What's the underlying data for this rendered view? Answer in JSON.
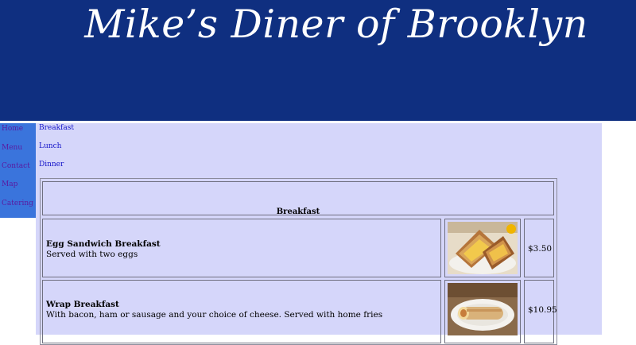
{
  "site": {
    "title": "Mike’s Diner of Brooklyn"
  },
  "nav": {
    "items": [
      {
        "label": "Home"
      },
      {
        "label": "Menu"
      },
      {
        "label": "Contact"
      },
      {
        "label": "Map"
      },
      {
        "label": "Catering"
      }
    ]
  },
  "submenu": {
    "links": [
      {
        "label": "Breakfast"
      },
      {
        "label": "Lunch"
      },
      {
        "label": "Dinner"
      }
    ]
  },
  "menu": {
    "section_title": "Breakfast",
    "items": [
      {
        "name": "Egg Sandwich Breakfast",
        "description": "Served with two eggs",
        "price": "$3.50",
        "image_icon": "egg-sandwich-photo"
      },
      {
        "name": "Wrap Breakfast",
        "description": "With bacon, ham or sausage and your choice of cheese. Served with home fries",
        "price": "$10.95",
        "image_icon": "breakfast-wrap-photo"
      }
    ]
  },
  "colors": {
    "header_bg": "#0f2f80",
    "sidebar_bg": "#3a74dc",
    "content_bg": "#d5d6fa",
    "nav_link": "#5a1aa0",
    "sub_link": "#1212c8"
  }
}
